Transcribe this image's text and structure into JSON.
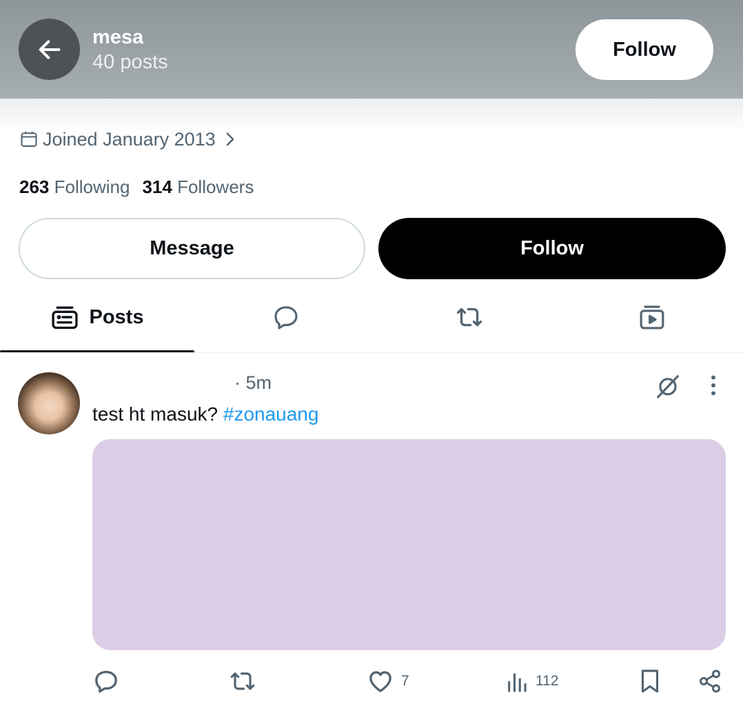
{
  "header": {
    "name": "mesa",
    "posts_count": "40 posts",
    "follow_label": "Follow",
    "colors": {
      "bar": "#8e969b",
      "back_button": "#4d5256"
    }
  },
  "profile": {
    "joined": "Joined January 2013",
    "following_count": "263",
    "following_label": "Following",
    "followers_count": "314",
    "followers_label": "Followers",
    "message_label": "Message",
    "follow_label": "Follow"
  },
  "tabs": [
    {
      "label": "Posts",
      "icon": "posts-icon",
      "active": true
    },
    {
      "label": "",
      "icon": "replies-icon",
      "active": false
    },
    {
      "label": "",
      "icon": "repost-icon",
      "active": false
    },
    {
      "label": "",
      "icon": "media-icon",
      "active": false
    }
  ],
  "post": {
    "time": "· 5m",
    "text": "test ht masuk? ",
    "hashtag": "#zonauang",
    "media_color": "#dccde6",
    "actions": {
      "reply_count": "",
      "repost_count": "",
      "like_count": "7",
      "views_count": "112"
    }
  },
  "colors": {
    "accent": "#1d9bf0",
    "text": "#0f1419",
    "secondary_text": "#536471"
  }
}
